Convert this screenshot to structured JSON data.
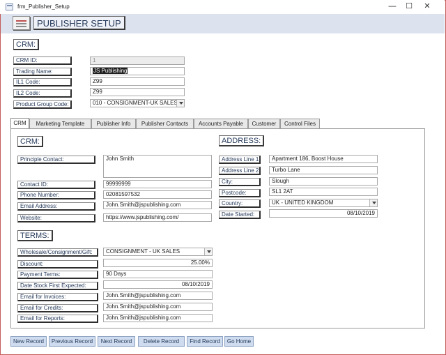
{
  "window": {
    "title": "frm_Publisher_Setup",
    "minimize": "—",
    "maximize": "☐",
    "close": "✕"
  },
  "header": {
    "title": "PUBLISHER SETUP"
  },
  "crm_top": {
    "section_title": "CRM:",
    "crm_id": {
      "label": "CRM ID:",
      "value": "1"
    },
    "trading_name": {
      "label": "Trading Name:",
      "value": "JS Publishing"
    },
    "il1_code": {
      "label": "IL1 Code:",
      "value": "Z99"
    },
    "il2_code": {
      "label": "IL2 Code:",
      "value": "Z99"
    },
    "product_group_code": {
      "label": "Product Group Code:",
      "value": "010 - CONSIGNMENT-UK SALES"
    }
  },
  "tabs": [
    {
      "label": "CRM"
    },
    {
      "label": "Marketing Template"
    },
    {
      "label": "Publisher Info"
    },
    {
      "label": "Publisher Contacts"
    },
    {
      "label": "Accounts Payable"
    },
    {
      "label": "Customer"
    },
    {
      "label": "Control Files"
    }
  ],
  "crm_tab": {
    "section_title": "CRM:",
    "principle_contact": {
      "label": "Principle Contact:",
      "value": "John Smith"
    },
    "contact_id": {
      "label": "Contact ID:",
      "value": "99999999"
    },
    "phone_number": {
      "label": "Phone Number:",
      "value": "02081597532"
    },
    "email_address": {
      "label": "Email Address:",
      "value": "John.Smith@jspublishing.com"
    },
    "website": {
      "label": "Website:",
      "value": "https://www.jspublishing.com/"
    }
  },
  "address": {
    "section_title": "ADDRESS:",
    "line1": {
      "label": "Address Line 1:",
      "value": "Apartment 186, Boost House"
    },
    "line2": {
      "label": "Address Line 2:",
      "value": "Turbo Lane"
    },
    "city": {
      "label": "City:",
      "value": "Slough"
    },
    "postcode": {
      "label": "Postcode:",
      "value": "SL1 2AT"
    },
    "country": {
      "label": "Country:",
      "value": "UK - UNITED KINGDOM"
    },
    "date_started": {
      "label": "Date Started:",
      "value": "08/10/2019"
    }
  },
  "terms": {
    "section_title": "TERMS:",
    "type": {
      "label": "Wholesale/Consignment/Gift:",
      "value": "CONSIGNMENT - UK SALES"
    },
    "discount": {
      "label": "Discount:",
      "value": "25.00%"
    },
    "payment_terms": {
      "label": "Payment Terms:",
      "value": "90 Days"
    },
    "date_stock": {
      "label": "Date Stock First Expected:",
      "value": "08/10/2019"
    },
    "email_invoices": {
      "label": "Email for Invoices:",
      "value": "John.Smith@jspublishing.com"
    },
    "email_credits": {
      "label": "Email for Credits:",
      "value": "John.Smith@jspublishing.com"
    },
    "email_reports": {
      "label": "Email for Reports:",
      "value": "John.Smith@jspublishing.com"
    }
  },
  "buttons": {
    "new_record": "New Record",
    "previous_record": "Previous Record",
    "next_record": "Next Record",
    "delete_record": "Delete Record",
    "find_record": "Find Record",
    "go_home": "Go Home"
  }
}
